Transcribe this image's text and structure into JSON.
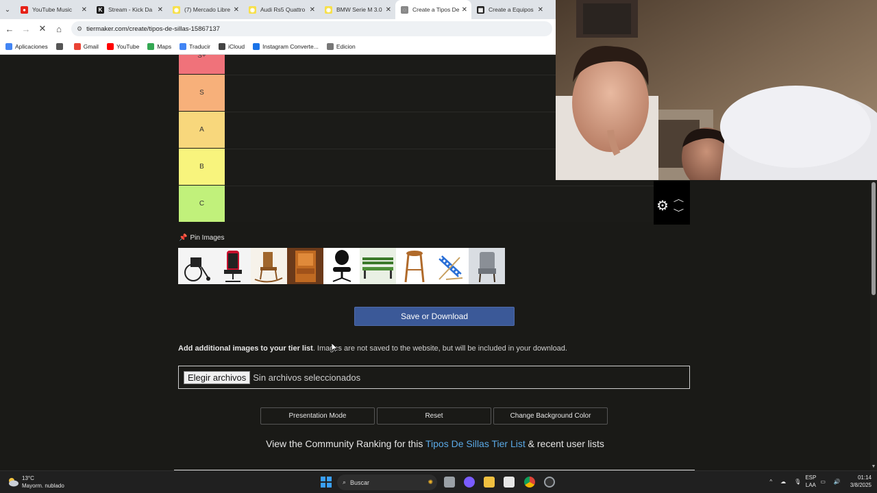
{
  "browser": {
    "tabs": [
      {
        "label": "YouTube Music",
        "color": "#e62117",
        "glyph": "●",
        "active": false
      },
      {
        "label": "Stream - Kick Da",
        "color": "#1b1b1b",
        "glyph": "K",
        "active": false
      },
      {
        "label": "(7) Mercado Libre",
        "color": "#f7e04b",
        "glyph": "◉",
        "active": false
      },
      {
        "label": "Audi Rs5 Quattro",
        "color": "#f7e04b",
        "glyph": "◉",
        "active": false
      },
      {
        "label": "BMW Serie M 3.0",
        "color": "#f7e04b",
        "glyph": "◉",
        "active": false
      },
      {
        "label": "Create a Tipos De",
        "color": "#888888",
        "glyph": "◌",
        "active": true
      },
      {
        "label": "Create a Equipos",
        "color": "#222222",
        "glyph": "▦",
        "active": false
      }
    ],
    "url": "tiermaker.com/create/tipos-de-sillas-15867137",
    "bookmarks": [
      {
        "label": "Aplicaciones",
        "icon": "apps-grid-icon"
      },
      {
        "label": "",
        "icon": "grid-icon"
      },
      {
        "label": "Gmail",
        "icon": "gmail-icon"
      },
      {
        "label": "YouTube",
        "icon": "youtube-icon"
      },
      {
        "label": "Maps",
        "icon": "maps-icon"
      },
      {
        "label": "Traducir",
        "icon": "translate-icon"
      },
      {
        "label": "iCloud",
        "icon": "apple-icon"
      },
      {
        "label": "Instagram Converte...",
        "icon": "download-icon"
      },
      {
        "label": "Edicion",
        "icon": "folder-icon"
      }
    ]
  },
  "tiers": [
    {
      "label": "S+",
      "color": "#f0727a"
    },
    {
      "label": "S",
      "color": "#f7b07a"
    },
    {
      "label": "A",
      "color": "#f8d77c"
    },
    {
      "label": "B",
      "color": "#f8f47d"
    },
    {
      "label": "C",
      "color": "#c1f17b"
    }
  ],
  "pin_images": {
    "label": "Pin Images",
    "items": [
      "wheelchair",
      "gaming-chair",
      "rocking-chair",
      "carved-wooden-chair",
      "office-chair",
      "park-bench",
      "bar-stool",
      "beach-chair",
      "upholstered-chair"
    ]
  },
  "save_button": "Save or Download",
  "add_images": {
    "bold": "Add additional images to your tier list",
    "rest": ". Images are not saved to the website, but will be included in your download."
  },
  "file_input": {
    "button": "Elegir archivos",
    "status": "Sin archivos seleccionados"
  },
  "buttons": {
    "presentation": "Presentation Mode",
    "reset": "Reset",
    "background": "Change Background Color"
  },
  "community": {
    "prefix": "View the Community Ranking for this ",
    "link": "Tipos De Sillas Tier List",
    "suffix": " & recent user lists"
  },
  "taskbar": {
    "weather_temp": "13°C",
    "weather_desc": "Mayorm. nublado",
    "search": "Buscar",
    "lang1": "ESP",
    "lang2": "LAA",
    "time": "01:14",
    "date": "3/8/2025"
  }
}
